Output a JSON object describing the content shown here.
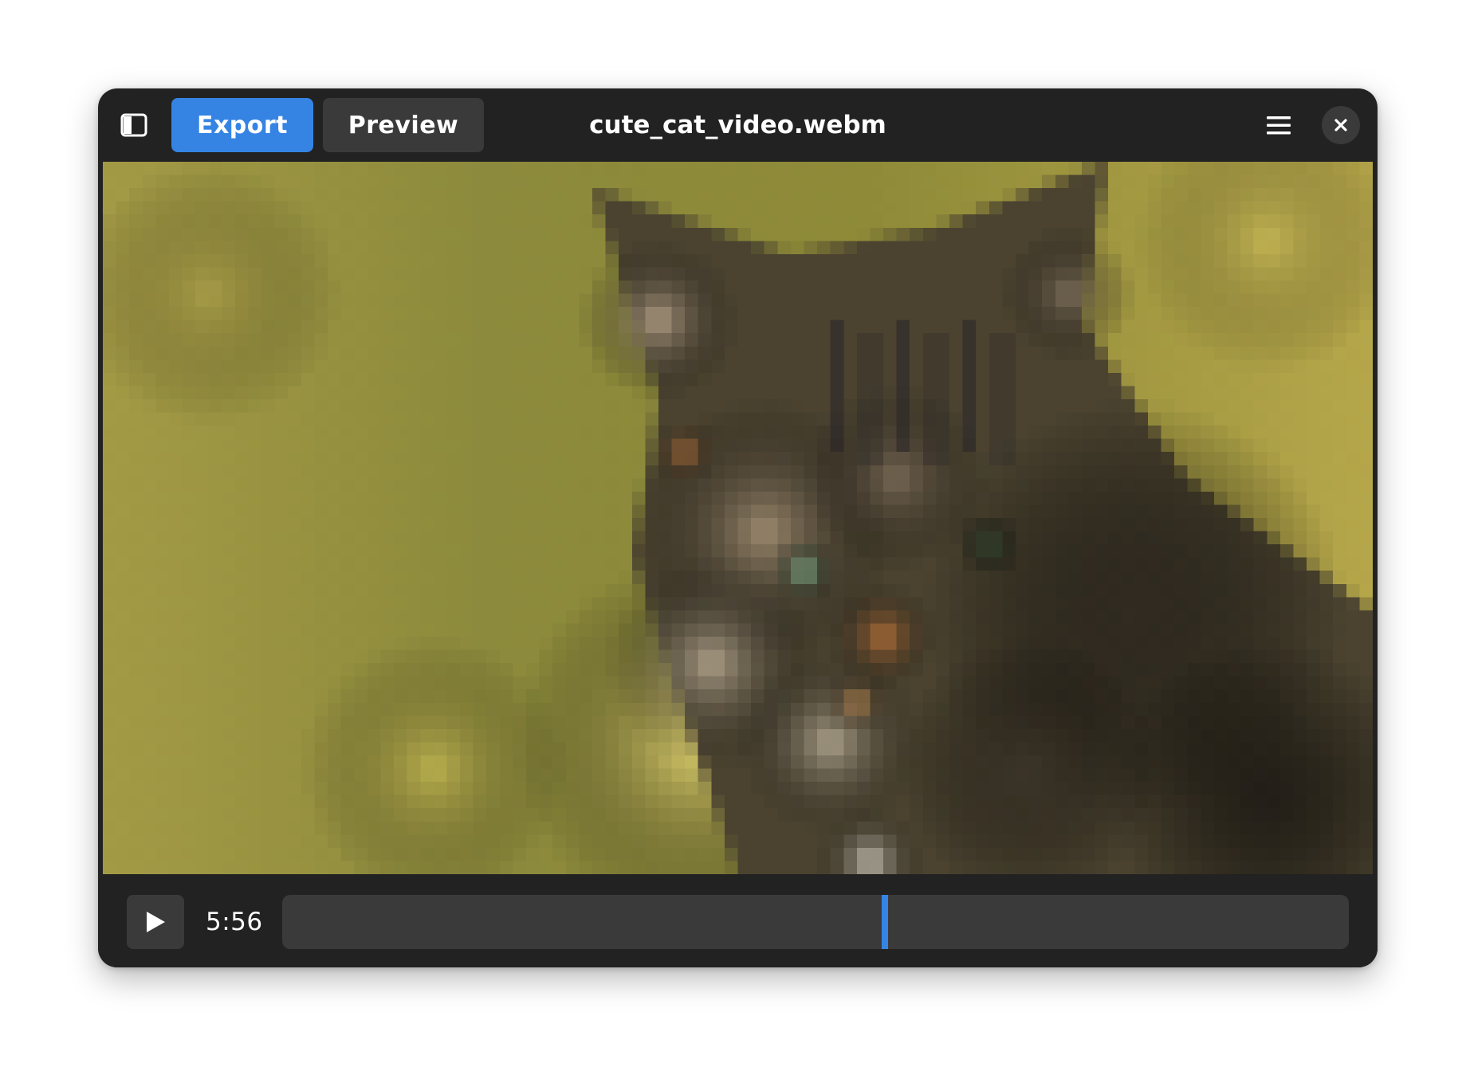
{
  "window": {
    "title": "cute_cat_video.webm"
  },
  "toolbar": {
    "export_label": "Export",
    "preview_label": "Preview",
    "sidebar_icon": "sidebar-toggle-icon",
    "menu_icon": "hamburger-menu-icon",
    "close_icon": "close-icon"
  },
  "player": {
    "time": "5:56",
    "progress": 0.565,
    "play_icon": "play-icon"
  },
  "colors": {
    "accent": "#3584e4",
    "window_bg": "#222222",
    "button_bg": "#3a3a3a"
  }
}
